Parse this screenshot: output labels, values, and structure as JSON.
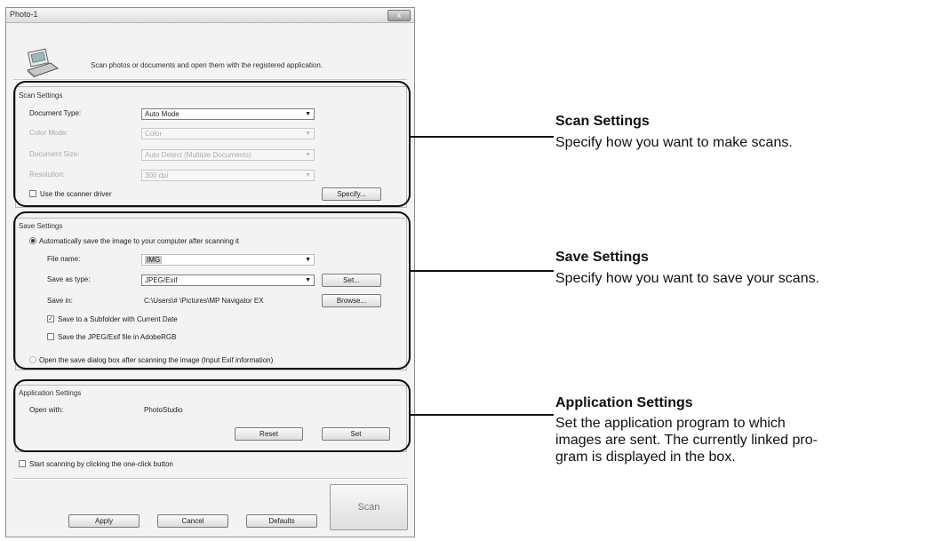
{
  "window": {
    "title": "Photo-1",
    "close": "x"
  },
  "description": "Scan photos or documents and open them with the registered application.",
  "scan_settings": {
    "group_title": "Scan Settings",
    "document_type": {
      "label": "Document Type:",
      "value": "Auto Mode"
    },
    "color_mode": {
      "label": "Color Mode:",
      "value": "Color"
    },
    "document_size": {
      "label": "Document Size:",
      "value": "Auto Detect (Multiple Documents)"
    },
    "resolution": {
      "label": "Resolution:",
      "value": "300 dpi"
    },
    "use_driver": "Use the scanner driver",
    "specify_button": "Specify..."
  },
  "save_settings": {
    "group_title": "Save Settings",
    "auto_save": "Automatically save the image to your computer after scanning it",
    "file_name": {
      "label": "File name:",
      "value": "IMG"
    },
    "save_as_type": {
      "label": "Save as type:",
      "value": "JPEG/Exif"
    },
    "set_button": "Set...",
    "save_in": {
      "label": "Save in:",
      "value": "C:\\Users\\# \\Pictures\\MP Navigator EX"
    },
    "browse_button": "Browse...",
    "subfolder": "Save to a Subfolder with Current Date",
    "adobergb": "Save the JPEG/Exif file in AdobeRGB",
    "open_dialog": "Open the save dialog box after scanning the image (Input Exif information)"
  },
  "application_settings": {
    "group_title": "Application Settings",
    "open_with": {
      "label": "Open with:",
      "value": "PhotoStudio"
    },
    "reset_button": "Reset",
    "set_button": "Set"
  },
  "one_click": "Start scanning by clicking the one-click button",
  "footer": {
    "apply": "Apply",
    "cancel": "Cancel",
    "defaults": "Defaults",
    "scan": "Scan"
  },
  "annotations": {
    "scan": {
      "title": "Scan Settings",
      "lines": [
        "Specify how you want to make scans."
      ]
    },
    "save": {
      "title": "Save Settings",
      "lines": [
        "Specify how you want to save your scans."
      ]
    },
    "app": {
      "title": "Application Settings",
      "lines": [
        "Set the application program to which",
        "images are sent. The currently linked pro-",
        "gram is displayed in the box."
      ]
    }
  }
}
